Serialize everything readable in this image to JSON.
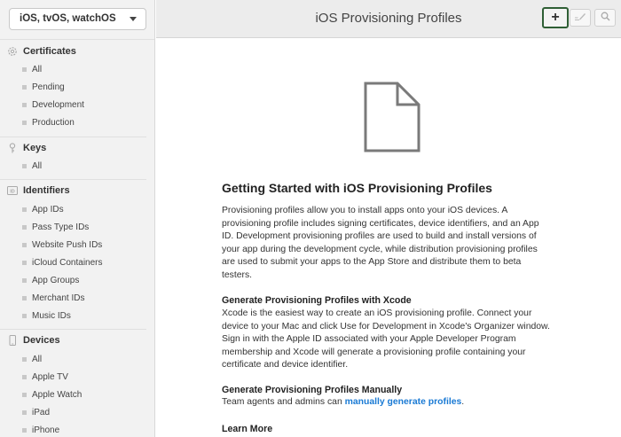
{
  "sidebar": {
    "platform_select": "iOS, tvOS, watchOS",
    "sections": {
      "certificates": {
        "title": "Certificates",
        "items": [
          "All",
          "Pending",
          "Development",
          "Production"
        ]
      },
      "keys": {
        "title": "Keys",
        "items": [
          "All"
        ]
      },
      "identifiers": {
        "title": "Identifiers",
        "items": [
          "App IDs",
          "Pass Type IDs",
          "Website Push IDs",
          "iCloud Containers",
          "App Groups",
          "Merchant IDs",
          "Music IDs"
        ]
      },
      "devices": {
        "title": "Devices",
        "items": [
          "All",
          "Apple TV",
          "Apple Watch",
          "iPad",
          "iPhone"
        ]
      }
    }
  },
  "header": {
    "title": "iOS Provisioning Profiles",
    "add_symbol": "+"
  },
  "main": {
    "heading": "Getting Started with iOS Provisioning Profiles",
    "intro": "Provisioning profiles allow you to install apps onto your iOS devices. A provisioning profile includes signing certificates, device identifiers, and an App ID. Development provisioning profiles are used to build and install versions of your app during the development cycle, while distribution provisioning profiles are used to submit your apps to the App Store and distribute them to beta testers.",
    "xcode_heading": "Generate Provisioning Profiles with Xcode",
    "xcode_text": "Xcode is the easiest way to create an iOS provisioning profile. Connect your device to your Mac and click Use for Development in Xcode's Organizer window. Sign in with the Apple ID associated with your Apple Developer Program membership and Xcode will generate a provisioning profile containing your certificate and device identifier.",
    "manual_heading": "Generate Provisioning Profiles Manually",
    "manual_text": "Team agents and admins can ",
    "manual_link": "manually generate profiles",
    "manual_period": ".",
    "learn_more": "Learn More"
  },
  "colors": {
    "link": "#1a7ad4",
    "add_button_border": "#2f5f35"
  },
  "icons": {
    "certificates": "gear-icon",
    "keys": "key-icon",
    "identifiers": "id-icon",
    "devices": "device-icon",
    "edit": "pencil-icon",
    "search": "search-icon"
  }
}
